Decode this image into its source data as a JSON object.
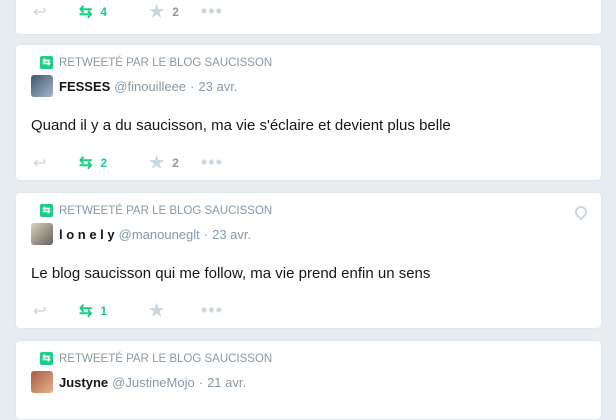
{
  "tweets": [
    {
      "text": "",
      "retweet_count": "4",
      "like_count": "2"
    },
    {
      "retweet_label": "RETWEETÉ PAR LE BLOG SAUCISSON",
      "name": "FESSES",
      "handle": "@finouilleee",
      "separator": "·",
      "date": "23 avr.",
      "text": "Quand il y a du saucisson, ma vie s'éclaire et devient plus belle",
      "retweet_count": "2",
      "like_count": "2"
    },
    {
      "retweet_label": "RETWEETÉ PAR LE BLOG SAUCISSON",
      "name": "l o n e l y",
      "handle": "@manouneglt",
      "separator": "·",
      "date": "23 avr.",
      "text": "Le blog saucisson qui me follow, ma vie prend enfin un sens",
      "retweet_count": "1",
      "like_count": ""
    },
    {
      "retweet_label": "RETWEETÉ PAR LE BLOG SAUCISSON",
      "name": "Justyne",
      "handle": "@JustineMojo",
      "separator": "·",
      "date": "21 avr."
    }
  ],
  "icons": {
    "retweet": "retweet-icon",
    "reply": "reply-icon",
    "like": "star-icon",
    "more": "more-icon",
    "location": "location-pin-icon"
  },
  "colors": {
    "retweet_green": "#19cf86",
    "muted": "#8899a6",
    "background": "#e6ecf0"
  }
}
